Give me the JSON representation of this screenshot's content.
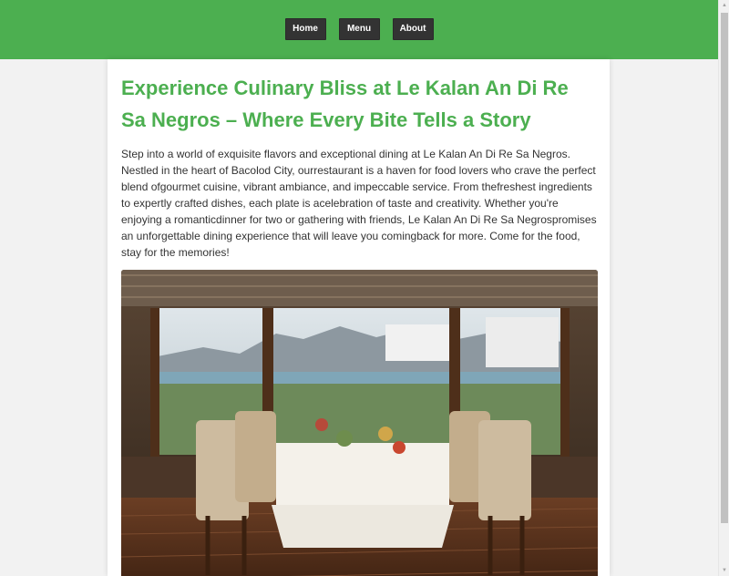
{
  "nav": {
    "home_label": "Home",
    "menu_label": "Menu",
    "about_label": "About"
  },
  "main": {
    "title": "Experience Culinary Bliss at Le Kalan An Di Re Sa Negros – Where Every Bite Tells a Story",
    "intro": "Step into a world of exquisite flavors and exceptional dining at Le Kalan An Di Re Sa Negros. Nestled in the heart of Bacolod City, ourrestaurant is a haven for food lovers who crave the perfect blend ofgourmet cuisine, vibrant ambiance, and impeccable service. From thefreshest ingredients to expertly crafted dishes, each plate is acelebration of taste and creativity. Whether you're enjoying a romanticdinner for two or gathering with friends, Le Kalan An Di Re Sa Negrospromises an unforgettable dining experience that will leave you comingback for more. Come for the food, stay for the memories!"
  },
  "colors": {
    "brand_green": "#4caf50",
    "nav_button_bg": "#333333"
  },
  "icons": {
    "scroll_up": "triangle-up-icon",
    "scroll_down": "triangle-down-icon"
  }
}
